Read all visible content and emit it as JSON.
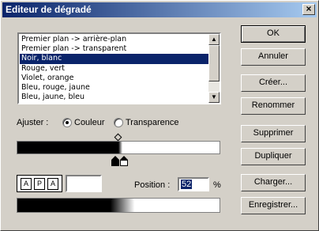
{
  "window": {
    "title": "Editeur de dégradé",
    "close_glyph": "×"
  },
  "presets": {
    "items": [
      "Premier plan -> arrière-plan",
      "Premier plan -> transparent",
      "Noir, blanc",
      "Rouge, vert",
      "Violet, orange",
      "Bleu, rouge, jaune",
      "Bleu, jaune, bleu"
    ],
    "selected_index": 2
  },
  "adjust": {
    "label": "Ajuster :",
    "options": [
      "Couleur",
      "Transparence"
    ],
    "selected": "Couleur"
  },
  "gradient": {
    "left_color": "#000000",
    "right_color": "#ffffff"
  },
  "stop_buttons": [
    "A",
    "P",
    "A"
  ],
  "position": {
    "label": "Position :",
    "value": "52",
    "unit": "%"
  },
  "buttons": {
    "ok": "OK",
    "cancel": "Annuler",
    "create": "Créer...",
    "rename": "Renommer",
    "delete": "Supprimer",
    "duplicate": "Dupliquer",
    "load": "Charger...",
    "save": "Enregistrer..."
  }
}
